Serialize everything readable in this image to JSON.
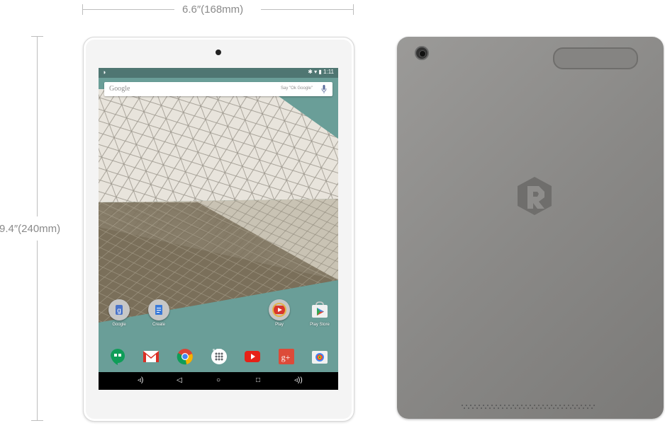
{
  "dimensions": {
    "width_label": "6.6″(168mm)",
    "height_label": "9.4″(240mm)"
  },
  "status_bar": {
    "time": "1:11"
  },
  "search": {
    "logo": "Google",
    "hint": "Say \"Ok Google\""
  },
  "apps": [
    {
      "label": "Google",
      "icon": "google-folder-icon"
    },
    {
      "label": "Create",
      "icon": "create-folder-icon"
    },
    {
      "label": "Play",
      "icon": "play-movies-icon"
    },
    {
      "label": "Play Store",
      "icon": "play-store-icon"
    }
  ],
  "dock": [
    "hangouts-icon",
    "gmail-icon",
    "chrome-icon",
    "app-drawer-icon",
    "youtube-icon",
    "google-plus-icon",
    "camera-icon"
  ],
  "nav": [
    "volume-down-icon",
    "back-icon",
    "home-icon",
    "recents-icon",
    "volume-up-icon"
  ],
  "colors": {
    "wallpaper_teal": "#6a9e98",
    "tablet_back": "#8e8d8b",
    "dimension_text": "#8a8a8a"
  }
}
